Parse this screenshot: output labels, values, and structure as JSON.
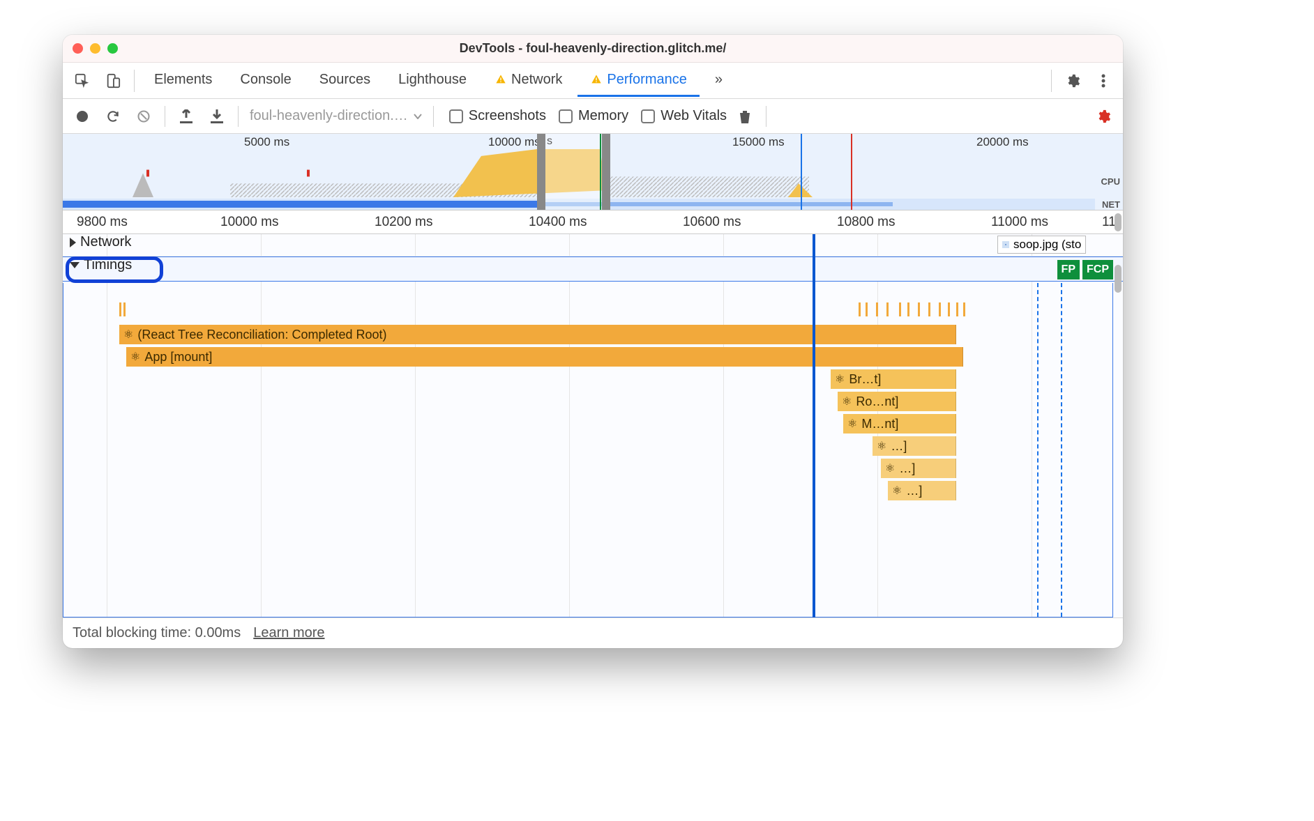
{
  "window": {
    "title": "DevTools - foul-heavenly-direction.glitch.me/"
  },
  "tabs": {
    "items": [
      "Elements",
      "Console",
      "Sources",
      "Lighthouse",
      "Network",
      "Performance"
    ],
    "more": "»",
    "active_index": 5,
    "warning_indices": [
      4,
      5
    ]
  },
  "toolbar": {
    "dropdown_label": "foul-heavenly-direction.…",
    "screenshots": "Screenshots",
    "memory": "Memory",
    "webvitals": "Web Vitals"
  },
  "overview": {
    "ticks": [
      "5000 ms",
      "10000 ms",
      "15000 ms",
      "20000 ms"
    ],
    "cpu_label": "CPU",
    "net_label": "NET",
    "selection_marker": "s"
  },
  "ruler": {
    "ticks": [
      "9800 ms",
      "10000 ms",
      "10200 ms",
      "10400 ms",
      "10600 ms",
      "10800 ms",
      "11000 ms",
      "11"
    ]
  },
  "tracks": {
    "network_label": "Network",
    "timings_label": "Timings",
    "net_chip": "soop.jpg (sto",
    "fp": "FP",
    "fcp": "FCP",
    "bars": {
      "reconcile": "(React Tree Reconciliation: Completed Root)",
      "app_mount": "App [mount]",
      "br": "Br…t]",
      "ro": "Ro…nt]",
      "m": "M…nt]",
      "e1": "…]",
      "e2": "…]",
      "e3": "…]"
    }
  },
  "footer": {
    "tbt": "Total blocking time: 0.00ms",
    "learn": "Learn more"
  },
  "colors": {
    "accent": "#1a73e8",
    "warn": "#f2a93b",
    "green": "#0f8f3c",
    "red": "#d93025"
  }
}
